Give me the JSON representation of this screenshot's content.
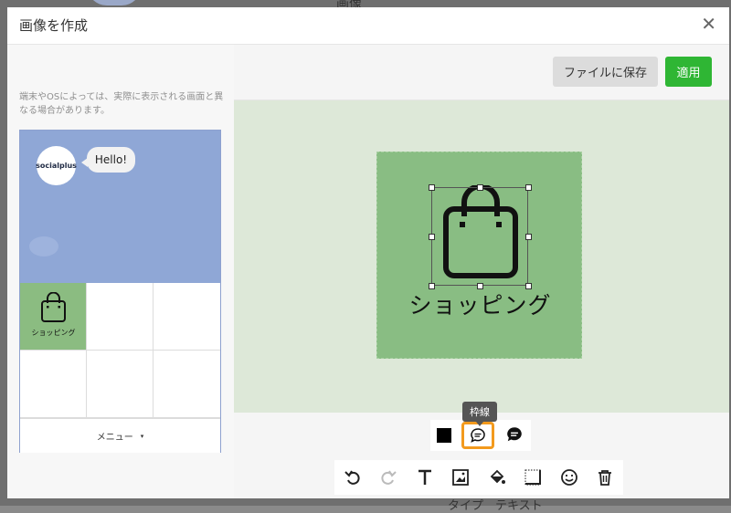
{
  "background": {
    "peek_title": "画像",
    "peek_bottom": "タイプ　テキスト"
  },
  "modal": {
    "title": "画像を作成",
    "close_icon": "close-icon"
  },
  "left": {
    "note": "端末やOSによっては、実際に表示される画面と異なる場合があります。",
    "preview": {
      "bot_name": "socialplus",
      "bubble_text": "Hello!",
      "grid": {
        "shop_label": "ショッピング"
      },
      "menu_label": "メニュー",
      "menu_caret": "▾"
    }
  },
  "toolbar": {
    "save_label": "ファイルに保存",
    "apply_label": "適用"
  },
  "canvas": {
    "text": "ショッピング",
    "bg_color": "#89bd83",
    "area_color": "#dde8d8"
  },
  "style_tools": {
    "tooltip": "枠線",
    "fill_icon": "square-fill-icon",
    "frame_icon": "speech-bubble-outline-icon",
    "solid_icon": "speech-bubble-solid-icon"
  },
  "tools": [
    {
      "name": "undo-icon"
    },
    {
      "name": "redo-icon"
    },
    {
      "name": "text-icon"
    },
    {
      "name": "image-icon"
    },
    {
      "name": "fill-bucket-icon"
    },
    {
      "name": "border-icon"
    },
    {
      "name": "emoji-icon"
    },
    {
      "name": "trash-icon"
    }
  ],
  "colors": {
    "apply_green": "#2fb634",
    "highlight_orange": "#f39a1d",
    "preview_blue": "#8fa7d6"
  }
}
